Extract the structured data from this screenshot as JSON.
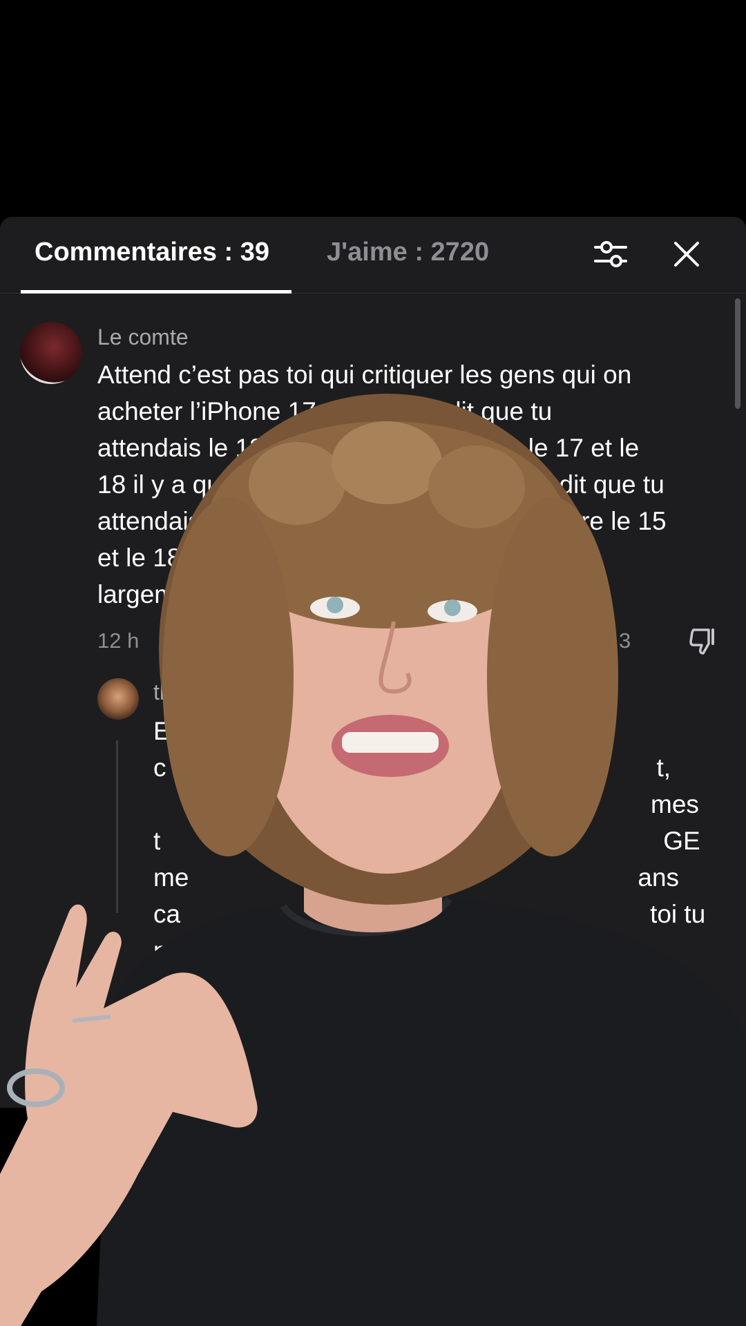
{
  "tabs": {
    "comments_label": "Commentaires : 39",
    "likes_label": "J'aime : 2720"
  },
  "icons": {
    "filter": "sliders-icon",
    "close": "close-icon",
    "dislike": "thumbs-down-icon"
  },
  "comment": {
    "author": "Le comte",
    "lines": [
      "Attend c’est pas toi qui critiquer les gens qui on",
      "acheter l’iPhone 17 mais tu as dit que tu",
      "attendais le 18 p",
      "r ? Entre le 17 et le",
      "18 il y a qu’un",
      "u as dit que tu",
      "attendais le",
      "ntre le 15",
      "et le 18 y",
      "largeme"
    ],
    "time": "12 h",
    "reply_label": "R",
    "likes": "3"
  },
  "reply": {
    "author": "th",
    "fragments": [
      "E",
      "t,",
      "c",
      "mes",
      "t",
      "GE",
      "me",
      "ans",
      "ca",
      "toi tu",
      "p"
    ]
  },
  "colors": {
    "panel_bg": "#1d1d1f",
    "text_primary": "#ffffff",
    "text_secondary": "#8e8e93",
    "page_bg": "#000000"
  }
}
